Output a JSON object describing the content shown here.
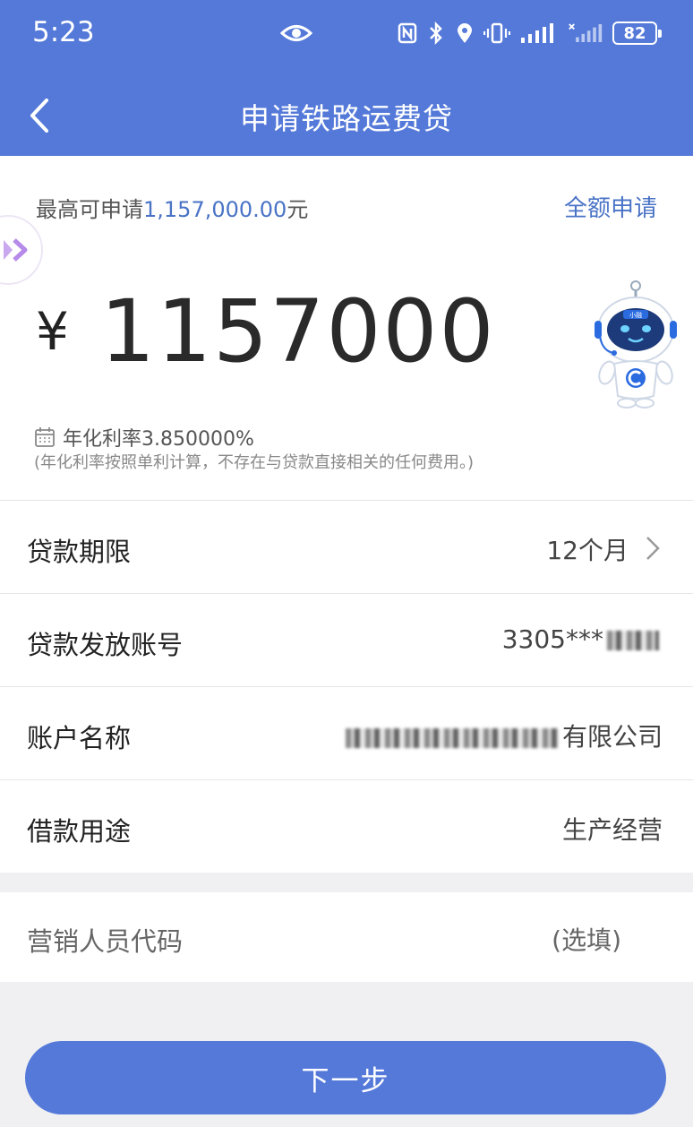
{
  "status_bar": {
    "time": "5:23",
    "battery": "82"
  },
  "header": {
    "title": "申请铁路运费贷"
  },
  "loan": {
    "max_prefix": "最高可申请",
    "max_amount": "1,157,000.00",
    "max_suffix": "元",
    "full_apply_label": "全额申请",
    "currency_symbol": "¥",
    "amount": "1157000",
    "rate_label": "年化利率3.850000%",
    "rate_note": "(年化利率按照单利计算，不存在与贷款直接相关的任何费用。)",
    "mascot_badge": "小融"
  },
  "form": {
    "term": {
      "label": "贷款期限",
      "value": "12个月"
    },
    "account": {
      "label": "贷款发放账号",
      "value": "3305***"
    },
    "account_name": {
      "label": "账户名称",
      "value": "有限公司"
    },
    "purpose": {
      "label": "借款用途",
      "value": "生产经营"
    },
    "referrer": {
      "label": "营销人员代码",
      "placeholder": "(选填)"
    }
  },
  "actions": {
    "next_label": "下一步"
  },
  "colors": {
    "brand_blue": "#5479d9",
    "link_blue": "#4a73c6",
    "page_bg": "#f0f0f2"
  }
}
